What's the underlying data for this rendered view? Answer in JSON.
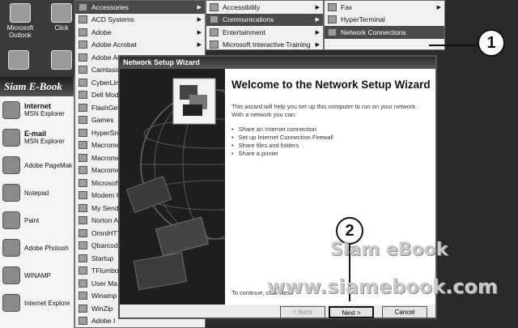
{
  "desktop": {
    "icons": [
      {
        "label": "Microsoft Outlook",
        "icon": "outlook-icon"
      },
      {
        "label": "Click",
        "icon": "app-icon"
      }
    ]
  },
  "start_menu": {
    "banner": "Siam E-Book",
    "pinned": [
      {
        "title": "Internet",
        "subtitle": "MSN Explorer",
        "icon": "internet-icon"
      },
      {
        "title": "E-mail",
        "subtitle": "MSN Explorer",
        "icon": "email-icon"
      }
    ],
    "recent": [
      {
        "label": "Adobe PageMak",
        "icon": "pagemaker-icon"
      },
      {
        "label": "Notepad",
        "icon": "notepad-icon"
      },
      {
        "label": "Paint",
        "icon": "paint-icon"
      },
      {
        "label": "Adobe Photosh",
        "icon": "photoshop-icon"
      },
      {
        "label": "WINAMP",
        "icon": "winamp-icon"
      },
      {
        "label": "Internet Explore",
        "icon": "ie-icon"
      }
    ]
  },
  "programs_menu": {
    "items": [
      {
        "label": "Accessories",
        "submenu": true,
        "highlight": true
      },
      {
        "label": "ACD Systems",
        "submenu": true
      },
      {
        "label": "Adobe",
        "submenu": true
      },
      {
        "label": "Adobe Acrobat",
        "submenu": true
      },
      {
        "label": "Adobe Ac",
        "submenu": false
      },
      {
        "label": "Camtasia",
        "submenu": false
      },
      {
        "label": "CyberLink",
        "submenu": false
      },
      {
        "label": "Dell Mode",
        "submenu": false
      },
      {
        "label": "FlashGet",
        "submenu": false
      },
      {
        "label": "Games",
        "submenu": false
      },
      {
        "label": "HyperSna",
        "submenu": false
      },
      {
        "label": "Macrome",
        "submenu": false
      },
      {
        "label": "Macrome",
        "submenu": false
      },
      {
        "label": "Macrome",
        "submenu": false
      },
      {
        "label": "Microsoft",
        "submenu": false
      },
      {
        "label": "Modem H",
        "submenu": false
      },
      {
        "label": "My Send S",
        "submenu": false
      },
      {
        "label": "Norton A",
        "submenu": false
      },
      {
        "label": "OmniHTT",
        "submenu": false
      },
      {
        "label": "Qbarcode",
        "submenu": false
      },
      {
        "label": "Startup",
        "submenu": false
      },
      {
        "label": "TFlumboP",
        "submenu": false
      },
      {
        "label": "User Ma",
        "submenu": false
      },
      {
        "label": "Winamp",
        "submenu": false
      },
      {
        "label": "WinZip",
        "submenu": false
      },
      {
        "label": "Adobe I",
        "submenu": false
      }
    ]
  },
  "accessories_menu": {
    "items": [
      {
        "label": "Accessibility",
        "submenu": true
      },
      {
        "label": "Communications",
        "submenu": true,
        "highlight": true
      },
      {
        "label": "Entertainment",
        "submenu": true
      },
      {
        "label": "Microsoft Interactive Training",
        "submenu": true
      }
    ]
  },
  "communications_menu": {
    "items": [
      {
        "label": "Fax",
        "submenu": true
      },
      {
        "label": "HyperTerminal",
        "submenu": false
      },
      {
        "label": "Network Connections",
        "submenu": false,
        "highlight": true
      }
    ]
  },
  "callouts": {
    "one": "1",
    "two": "2"
  },
  "wizard": {
    "window_title": "Network Setup Wizard",
    "heading": "Welcome to the Network Setup Wizard",
    "intro": "This wizard will help you set up this computer to run on your network. With a network you can:",
    "bullets": [
      "Share an Internet connection",
      "Set up Internet Connection Firewall",
      "Share files and folders",
      "Share a printer"
    ],
    "footer": "To continue, click Next.",
    "buttons": {
      "back": "< Back",
      "next": "Next >",
      "cancel": "Cancel"
    }
  },
  "watermark": {
    "line1": "Siam eBook",
    "line2": "www.siamebook.com"
  }
}
